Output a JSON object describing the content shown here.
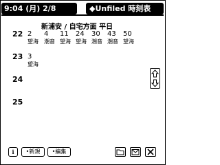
{
  "title_bar": {
    "datetime": "9:04 (月) 2/8",
    "category": "◆Unfiled 時刻表"
  },
  "header": {
    "route": "新浦安 / 自宅方面 平日"
  },
  "timetable": [
    {
      "hour": "22",
      "entries": [
        {
          "min": "2",
          "dest": "望海"
        },
        {
          "min": "4",
          "dest": "潮音"
        },
        {
          "min": "11",
          "dest": "望海"
        },
        {
          "min": "24",
          "dest": "望海"
        },
        {
          "min": "30",
          "dest": "潮音"
        },
        {
          "min": "43",
          "dest": "潮音"
        },
        {
          "min": "50",
          "dest": "望海"
        }
      ]
    },
    {
      "hour": "23",
      "entries": [
        {
          "min": "3",
          "dest": "望海"
        }
      ]
    },
    {
      "hour": "24",
      "entries": []
    },
    {
      "hour": "25",
      "entries": []
    }
  ],
  "toolbar": {
    "info_label": "i",
    "new_label": "•新規",
    "edit_label": "•編集"
  },
  "icons": {
    "info": "info-icon",
    "folder": "folder-icon",
    "mail": "mail-icon",
    "close": "close-icon",
    "scroll_up": "scroll-up-icon",
    "scroll_down": "scroll-down-icon"
  }
}
